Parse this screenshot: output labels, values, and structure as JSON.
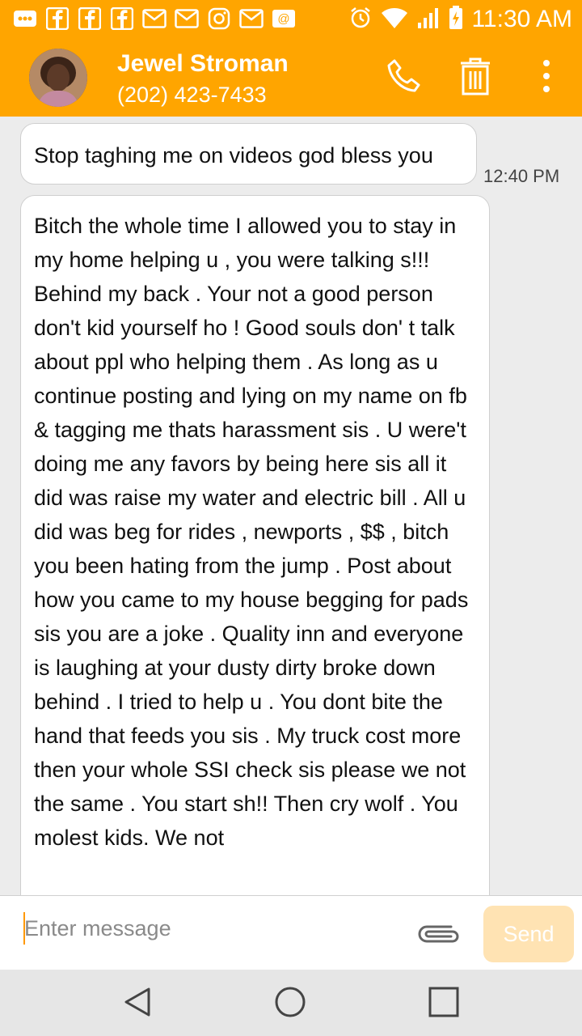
{
  "status_bar": {
    "time": "11:30 AM",
    "notification_icons": [
      "more-icon",
      "facebook-icon",
      "facebook-icon",
      "facebook-icon",
      "gmail-icon",
      "gmail-icon",
      "instagram-icon",
      "gmail-icon",
      "email-icon"
    ],
    "status_icons": [
      "alarm-icon",
      "wifi-icon",
      "signal-icon",
      "battery-icon"
    ]
  },
  "header": {
    "contact_name": "Jewel Stroman",
    "contact_number": "(202) 423-7433",
    "actions": [
      "call-icon",
      "delete-icon",
      "overflow-menu-icon"
    ]
  },
  "messages": [
    {
      "text": "Stop taghing me on videos god bless you",
      "time": "12:40 PM"
    },
    {
      "text": "Bitch the whole time I allowed you to stay in my home helping u , you were talking s!!! Behind my back . Your not a good person don't kid yourself ho ! Good souls don' t talk about ppl who helping them . As long as u continue posting and lying on my name on fb & tagging me thats harassment sis . U were't doing me any favors by being here sis all it did was raise my water and electric bill . All u did was beg for rides , newports , $$ , bitch you been hating from the jump . Post about how you came to my house begging for pads sis you are a joke . Quality inn and everyone is laughing at your dusty dirty broke down behind . I tried to help u . You dont bite the hand that feeds you sis . My truck cost more then your whole SSI check sis please we not the same . You start sh!! Then cry wolf . You molest kids. We not"
    }
  ],
  "composer": {
    "placeholder": "Enter message",
    "send_label": "Send",
    "attach_icon": "paperclip-icon"
  },
  "nav_bar": {
    "buttons": [
      "back-icon",
      "home-icon",
      "recents-icon"
    ]
  },
  "colors": {
    "accent": "#ffa500",
    "send_disabled": "#ffe3b3",
    "bubble": "#ffffff",
    "background": "#ececec"
  }
}
